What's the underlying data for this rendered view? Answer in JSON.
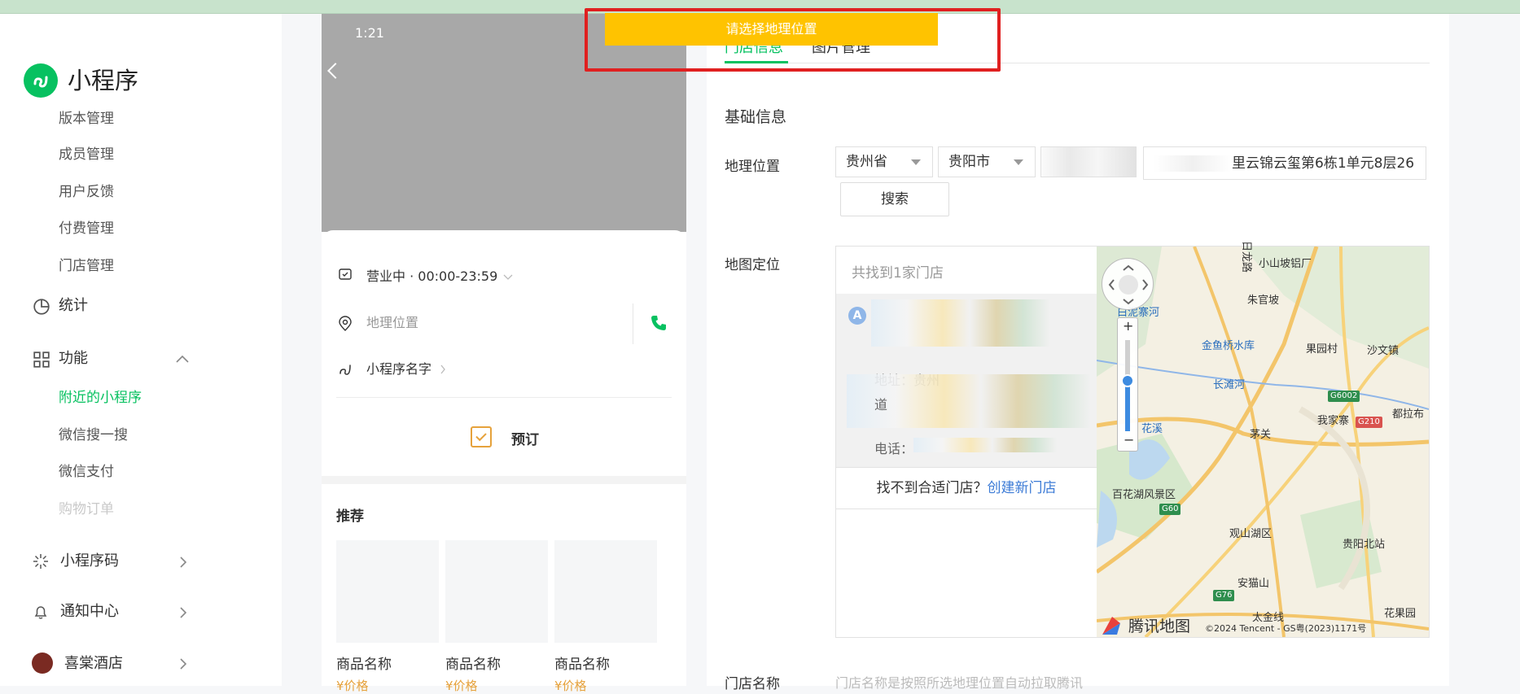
{
  "toast": {
    "text": "请选择地理位置"
  },
  "sidebar": {
    "brand": "小程序",
    "items_top": [
      "版本管理",
      "成员管理",
      "用户反馈",
      "付费管理",
      "门店管理"
    ],
    "stats": "统计",
    "func": "功能",
    "func_items": [
      "附近的小程序",
      "微信搜一搜",
      "微信支付",
      "购物订单"
    ],
    "code": "小程序码",
    "notice": "通知中心",
    "account": "喜棠酒店"
  },
  "phone": {
    "time": "1:21",
    "hours": "营业中 · 00:00-23:59",
    "location_placeholder": "地理位置",
    "mp_name": "小程序名字",
    "book": "预订",
    "recommend": "推荐",
    "products": [
      {
        "name": "商品名称",
        "price": "¥价格"
      },
      {
        "name": "商品名称",
        "price": "¥价格"
      },
      {
        "name": "商品名称",
        "price": "¥价格"
      }
    ]
  },
  "form": {
    "tabs": [
      "门店信息",
      "图片管理"
    ],
    "section": "基础信息",
    "geo_label": "地理位置",
    "province": "贵州省",
    "city": "贵阳市",
    "district": "",
    "address": "里云锦云玺第6栋1单元8层26",
    "search": "搜索",
    "map_label": "地图定位",
    "found": "共找到1家门店",
    "card_pin": "A",
    "card_addr": "地址：贵州",
    "card_road": "道",
    "card_tel": "电话：",
    "not_found": "找不到合适门店？",
    "create_link": "创建新门店",
    "store_name_label": "门店名称",
    "store_name_hint": "门店名称是按照所选地理位置自动拉取腾讯"
  },
  "map": {
    "brand": "腾讯地图",
    "copyright": "©2024 Tencent - GS粤(2023)1171号",
    "labels": [
      "日龙路",
      "小山坡铝厂",
      "朱官坡",
      "白泥寨河",
      "金鱼桥水库",
      "果园村",
      "沙文镇",
      "长滩河",
      "G6002",
      "茅关",
      "花溪",
      "百花湖风景区",
      "观山湖区",
      "G60",
      "G210",
      "贵阳北站",
      "安猫山",
      "G76",
      "太金线",
      "花果园",
      "我家寨",
      "都拉布"
    ]
  }
}
